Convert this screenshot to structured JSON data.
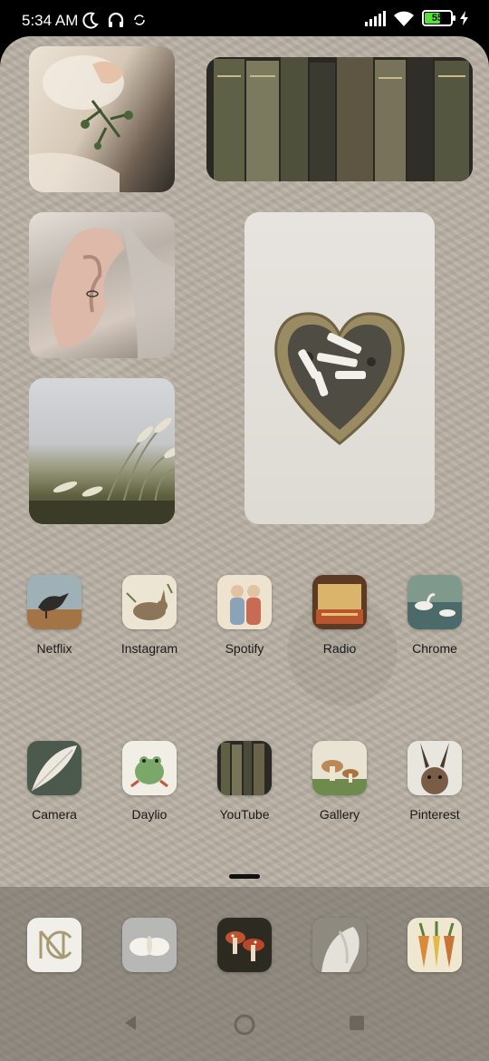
{
  "status_bar": {
    "time": "5:34 AM",
    "left_icons": [
      "moon-icon",
      "headphones-icon",
      "sync-icon"
    ],
    "right_icons": [
      "signal-icon",
      "wifi-icon",
      "battery-icon",
      "charging-icon"
    ],
    "battery_level": "55"
  },
  "widgets": [
    {
      "name": "photo-hand-flowers"
    },
    {
      "name": "photo-old-books"
    },
    {
      "name": "photo-elf-ear"
    },
    {
      "name": "photo-heart-ashtray"
    },
    {
      "name": "photo-pampas-grass"
    }
  ],
  "apps_row1": [
    {
      "label": "Netflix",
      "icon": "vintage-bird-illustration"
    },
    {
      "label": "Instagram",
      "icon": "vintage-rabbit-illustration"
    },
    {
      "label": "Spotify",
      "icon": "vintage-figures-illustration"
    },
    {
      "label": "Radio",
      "icon": "vintage-box-illustration"
    },
    {
      "label": "Chrome",
      "icon": "vintage-swans-illustration"
    }
  ],
  "apps_row2": [
    {
      "label": "Camera",
      "icon": "white-feather"
    },
    {
      "label": "Daylio",
      "icon": "vintage-frog-illustration"
    },
    {
      "label": "YouTube",
      "icon": "old-books"
    },
    {
      "label": "Gallery",
      "icon": "vintage-mushrooms-illustration"
    },
    {
      "label": "Pinterest",
      "icon": "hare-portrait"
    }
  ],
  "dock": [
    {
      "icon": "monogram-nc"
    },
    {
      "icon": "white-moth"
    },
    {
      "icon": "red-mushrooms"
    },
    {
      "icon": "white-horse"
    },
    {
      "icon": "vintage-carrots-illustration"
    }
  ],
  "nav": [
    "back-icon",
    "home-icon",
    "recents-icon"
  ]
}
